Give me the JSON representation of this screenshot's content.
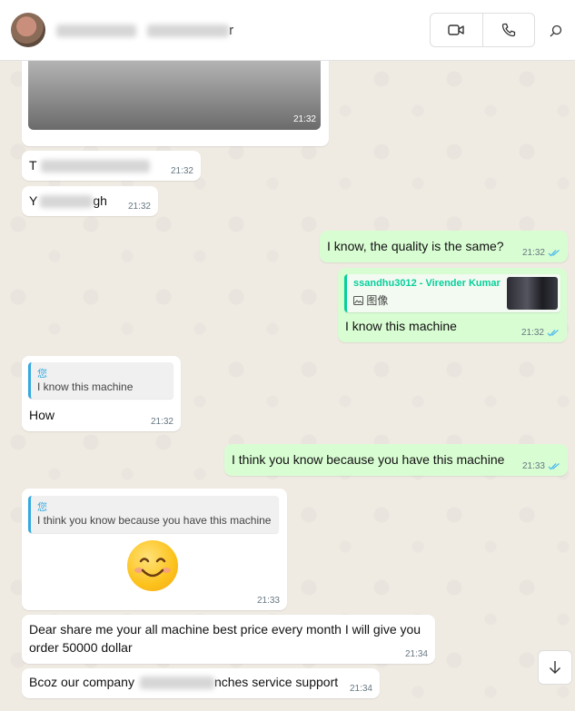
{
  "header": {
    "contact_name_visible_suffix": "r",
    "video_call_icon": "video-camera-icon",
    "voice_call_icon": "phone-icon",
    "search_icon": "search-icon"
  },
  "messages": {
    "m1": {
      "time": "21:32"
    },
    "m2": {
      "text_prefix": "T",
      "time": "21:32"
    },
    "m3": {
      "text_prefix": "Y",
      "text_suffix": "gh",
      "time": "21:32"
    },
    "m4": {
      "text": "I know, the quality is the same?",
      "time": "21:32"
    },
    "m5": {
      "quote_author": "ssandhu3012 - Virender Kumar",
      "quote_text": "图像",
      "text": "I know this machine",
      "time": "21:32"
    },
    "m6": {
      "quote_author": "您",
      "quote_text": "I know this machine",
      "text": "How",
      "time": "21:32"
    },
    "m7": {
      "text": "I think you know because you have this machine",
      "time": "21:33"
    },
    "m8": {
      "quote_author": "您",
      "quote_text": "I think you know because you have this machine",
      "emoji": "😊",
      "time": "21:33"
    },
    "m9": {
      "text_line1": "Dear share me your all machine best price every month I will give you",
      "text_line2": "order 50000 dollar",
      "time": "21:34"
    },
    "m10": {
      "text_prefix": "Bcoz our company",
      "text_suffix": "nches service support",
      "time": "21:34"
    }
  },
  "colors": {
    "outgoing": "#d9fdd3",
    "incoming": "#ffffff",
    "read_ticks": "#53bdeb",
    "quote_accent": "#35a8e0",
    "quote_author_green": "#06cf9c"
  }
}
